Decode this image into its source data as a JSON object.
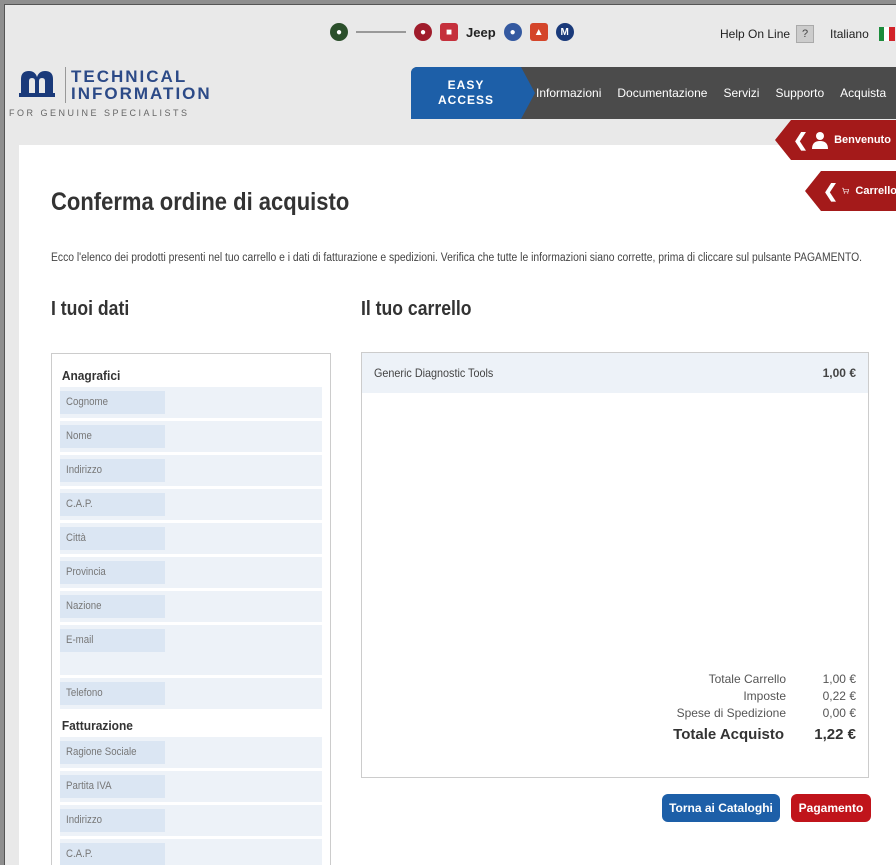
{
  "header": {
    "brand_jeep": "Jeep",
    "help_label": "Help On Line",
    "help_icon": "?",
    "language": "Italiano"
  },
  "logo": {
    "line1": "TECHNICAL",
    "line2": "INFORMATION",
    "tagline": "FOR GENUINE SPECIALISTS"
  },
  "nav": {
    "easy_line1": "EASY",
    "easy_line2": "ACCESS",
    "items": [
      "Informazioni",
      "Documentazione",
      "Servizi",
      "Supporto",
      "Acquista"
    ]
  },
  "side_tabs": {
    "benvenuto": "Benvenuto",
    "carrello": "Carrello"
  },
  "page": {
    "title": "Conferma ordine di acquisto",
    "intro": "Ecco l'elenco dei prodotti presenti nel tuo carrello e i dati di fatturazione e spedizioni. Verifica che tutte le informazioni siano corrette, prima di cliccare sul pulsante PAGAMENTO.",
    "dati_heading": "I tuoi dati",
    "carrello_heading": "Il tuo carrello"
  },
  "dati": {
    "anagrafici_title": "Anagrafici",
    "anagrafici": [
      "Cognome",
      "Nome",
      "Indirizzo",
      "C.A.P.",
      "Città",
      "Provincia",
      "Nazione",
      "E-mail",
      "Telefono"
    ],
    "fatturazione_title": "Fatturazione",
    "fatturazione": [
      "Ragione Sociale",
      "Partita IVA",
      "Indirizzo",
      "C.A.P."
    ]
  },
  "cart": {
    "item_name": "Generic Diagnostic Tools",
    "item_price": "1,00 €",
    "totale_carrello_label": "Totale Carrello",
    "totale_carrello": "1,00 €",
    "imposte_label": "Imposte",
    "imposte": "0,22 €",
    "spedizione_label": "Spese di Spedizione",
    "spedizione": "0,00 €",
    "totale_acquisto_label": "Totale Acquisto",
    "totale_acquisto": "1,22 €"
  },
  "buttons": {
    "torna": "Torna ai Cataloghi",
    "pagamento": "Pagamento"
  },
  "colors": {
    "primary_blue": "#1d5fa8",
    "accent_red": "#c0141b",
    "nav_dark": "#4b4b4b"
  }
}
